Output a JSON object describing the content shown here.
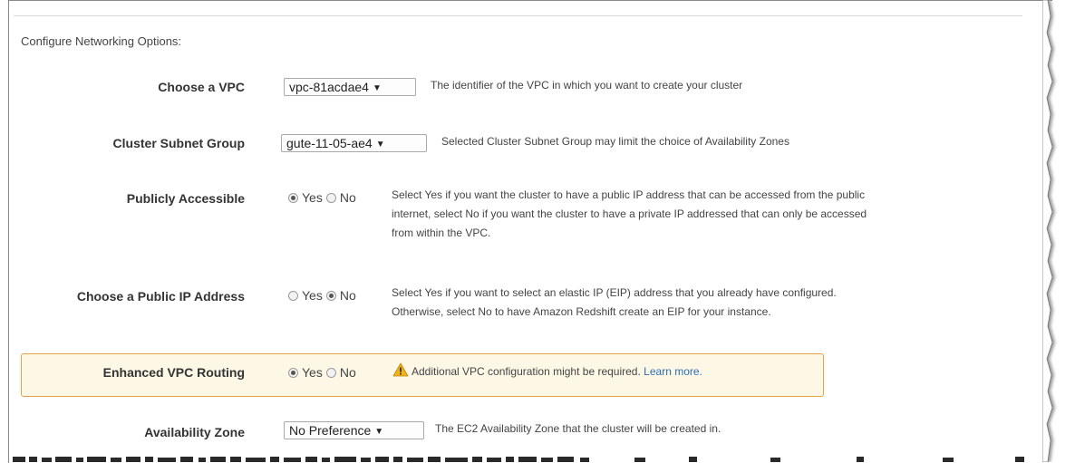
{
  "section_title": "Configure Networking Options:",
  "fields": {
    "vpc": {
      "label": "Choose a VPC",
      "value": "vpc-81acdae4",
      "help": "The identifier of the VPC in which you want to create your cluster"
    },
    "subnet_group": {
      "label": "Cluster Subnet Group",
      "value": "gute-11-05-ae4",
      "help": "Selected Cluster Subnet Group may limit the choice of Availability Zones"
    },
    "publicly_accessible": {
      "label": "Publicly Accessible",
      "yes_label": "Yes",
      "no_label": "No",
      "selected": "Yes",
      "help_lines": [
        "Select Yes if you want the cluster to have a public IP address that can be accessed from the public",
        "internet, select No if you want the cluster to have a private IP addressed that can only be accessed",
        "from within the VPC."
      ]
    },
    "public_ip": {
      "label": "Choose a Public IP Address",
      "yes_label": "Yes",
      "no_label": "No",
      "selected": "No",
      "help_lines": [
        "Select Yes if you want to select an elastic IP (EIP) address that you already have configured.",
        "Otherwise, select No to have Amazon Redshift create an EIP for your instance."
      ]
    },
    "enhanced_vpc_routing": {
      "label": "Enhanced VPC Routing",
      "yes_label": "Yes",
      "no_label": "No",
      "selected": "Yes",
      "warning": "Additional VPC configuration might be required.",
      "link": "Learn more."
    },
    "availability_zone": {
      "label": "Availability Zone",
      "value": "No Preference",
      "help": "The EC2 Availability Zone that the cluster will be created in."
    }
  },
  "colors": {
    "highlight_bg": "#fdf8e6",
    "highlight_border": "#e5a343",
    "link": "#2b6db3",
    "warning_icon": "#f0b41a"
  }
}
